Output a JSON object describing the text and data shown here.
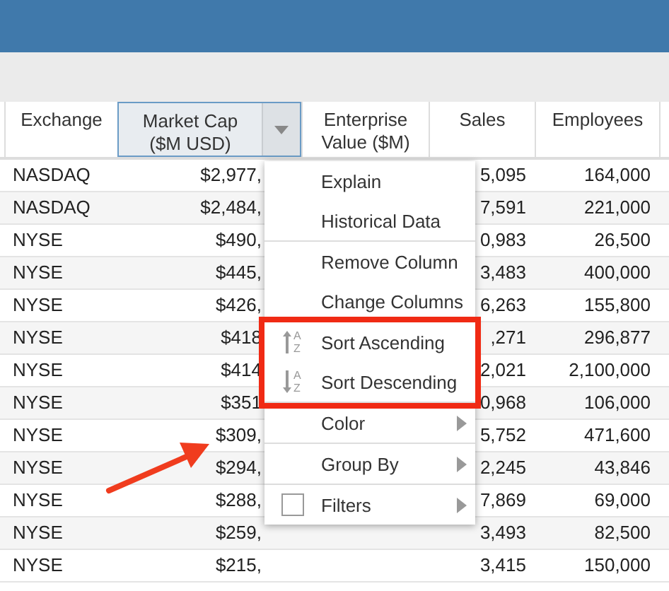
{
  "table": {
    "columns": [
      {
        "label": "Exchange",
        "selected": false
      },
      {
        "label": "Market Cap ($M USD)",
        "selected": true
      },
      {
        "label": "Enterprise Value ($M)",
        "selected": false
      },
      {
        "label": "Sales",
        "selected": false
      },
      {
        "label": "Employees",
        "selected": false
      }
    ],
    "rows": [
      [
        "NASDAQ",
        "$2,977,",
        "",
        "5,095",
        "164,000"
      ],
      [
        "NASDAQ",
        "$2,484,",
        "",
        "7,591",
        "221,000"
      ],
      [
        "NYSE",
        "$490,",
        "",
        "0,983",
        "26,500"
      ],
      [
        "NYSE",
        "$445,",
        "",
        "3,483",
        "400,000"
      ],
      [
        "NYSE",
        "$426,",
        "",
        "6,263",
        "155,800"
      ],
      [
        "NYSE",
        "$418",
        "",
        ",271",
        "296,877"
      ],
      [
        "NYSE",
        "$414",
        "",
        "2,021",
        "2,100,000"
      ],
      [
        "NYSE",
        "$351",
        "",
        "0,968",
        "106,000"
      ],
      [
        "NYSE",
        "$309,",
        "",
        "5,752",
        "471,600"
      ],
      [
        "NYSE",
        "$294,",
        "",
        "2,245",
        "43,846"
      ],
      [
        "NYSE",
        "$288,",
        "",
        "7,869",
        "69,000"
      ],
      [
        "NYSE",
        "$259,",
        "",
        "3,493",
        "82,500"
      ],
      [
        "NYSE",
        "$215,",
        "",
        "3,415",
        "150,000"
      ]
    ]
  },
  "menu": {
    "groups": [
      {
        "highlighted": false,
        "items": [
          {
            "label": "Explain",
            "kind": "plain"
          },
          {
            "label": "Historical Data",
            "kind": "plain"
          }
        ]
      },
      {
        "highlighted": false,
        "items": [
          {
            "label": "Remove Column",
            "kind": "plain"
          },
          {
            "label": "Change Columns",
            "kind": "plain"
          }
        ]
      },
      {
        "highlighted": true,
        "items": [
          {
            "label": "Sort Ascending",
            "kind": "sort_ascending",
            "icon_letters": [
              "A",
              "Z"
            ]
          },
          {
            "label": "Sort Descending",
            "kind": "sort_descending",
            "icon_letters": [
              "A",
              "Z"
            ]
          }
        ]
      },
      {
        "highlighted": false,
        "items": [
          {
            "label": "Color",
            "kind": "submenu"
          }
        ]
      },
      {
        "highlighted": false,
        "items": [
          {
            "label": "Group By",
            "kind": "submenu"
          }
        ]
      },
      {
        "highlighted": false,
        "items": [
          {
            "label": "Filters",
            "kind": "checkbox_submenu",
            "checked": false
          }
        ]
      }
    ]
  }
}
